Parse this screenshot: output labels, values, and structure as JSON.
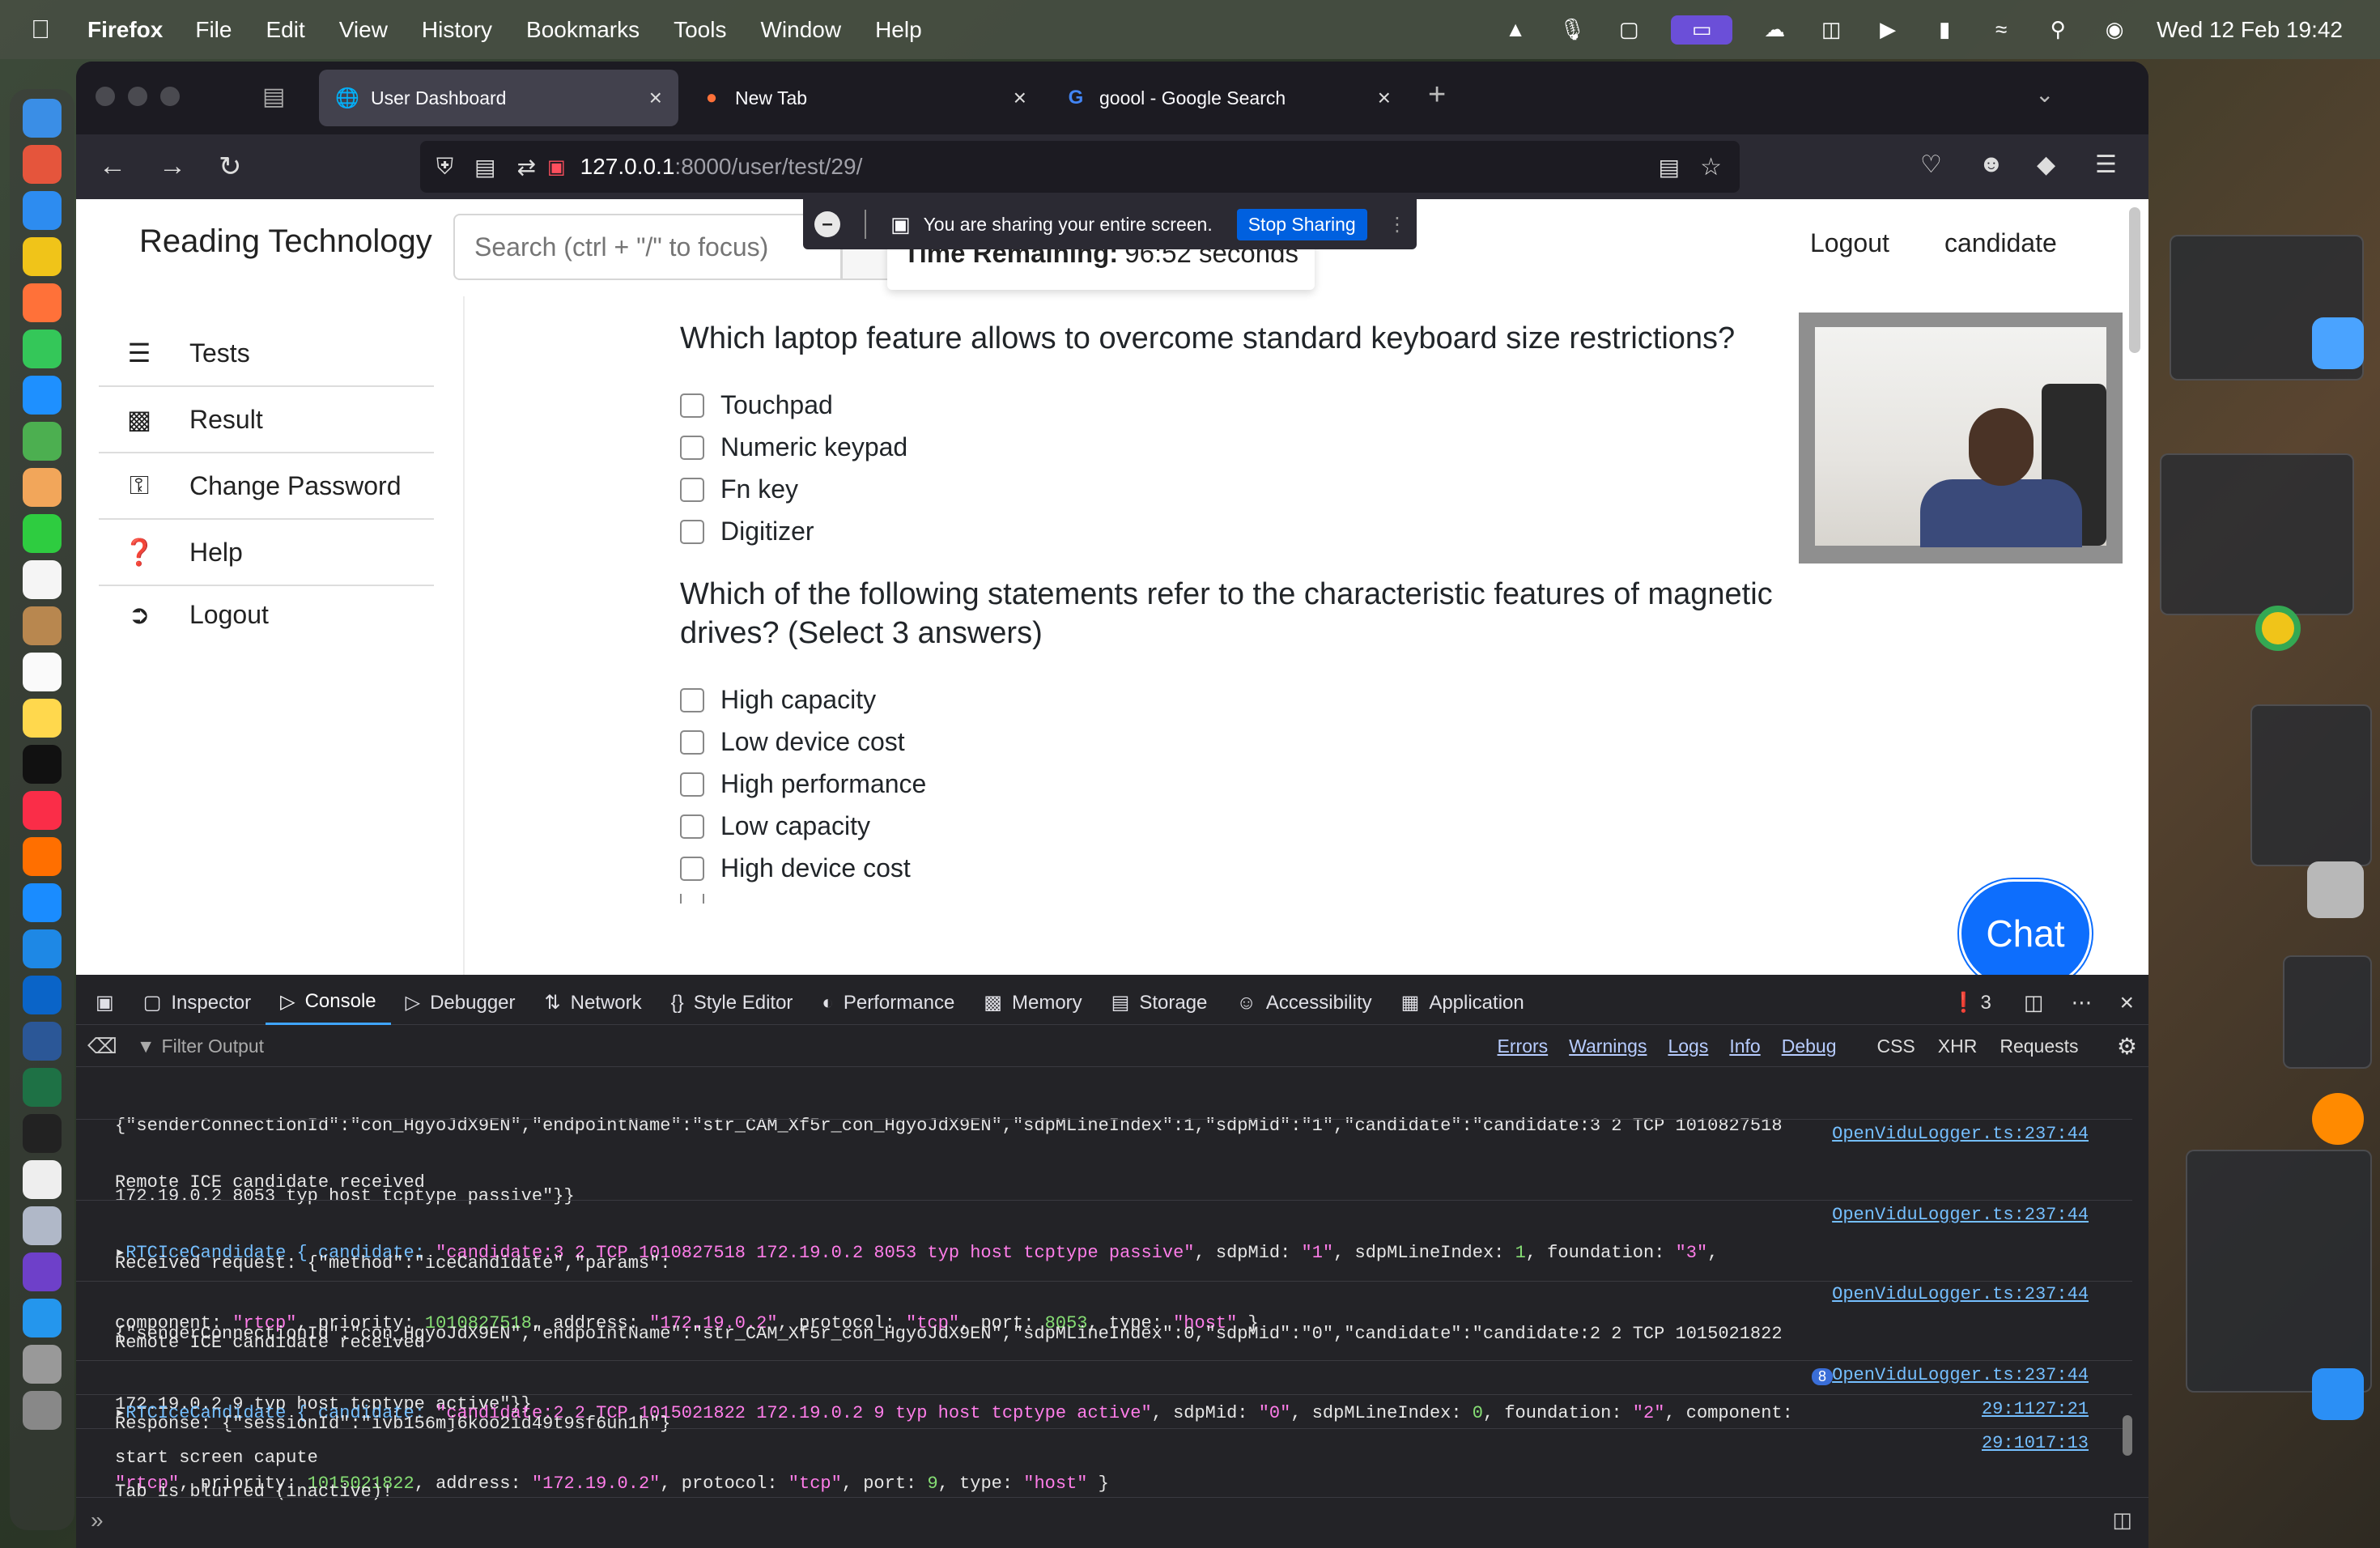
{
  "menubar": {
    "app_name": "Firefox",
    "menus": [
      "File",
      "Edit",
      "View",
      "History",
      "Bookmarks",
      "Tools",
      "Window",
      "Help"
    ],
    "clock": "Wed 12 Feb  19:42"
  },
  "browser": {
    "tabs": [
      {
        "label": "User Dashboard",
        "icon": "globe-icon"
      },
      {
        "label": "New Tab",
        "icon": "firefox-icon"
      },
      {
        "label": "goool - Google Search",
        "icon": "google-icon"
      }
    ],
    "url_host": "127.0.0.1",
    "url_rest": ":8000/user/test/29/"
  },
  "share_bar": {
    "message": "You are sharing your entire screen.",
    "stop_label": "Stop Sharing"
  },
  "site": {
    "brand": "Reading Technology",
    "search_placeholder": "Search (ctrl + \"/\" to focus)",
    "top_links": [
      "Logout",
      "candidate"
    ],
    "sidebar": [
      {
        "label": "Tests",
        "icon": "list-icon"
      },
      {
        "label": "Result",
        "icon": "clipboard-icon"
      },
      {
        "label": "Change Password",
        "icon": "key-icon"
      },
      {
        "label": "Help",
        "icon": "question-circle-icon"
      },
      {
        "label": "Logout",
        "icon": "sign-out-icon"
      }
    ],
    "timer_label": "Time Remaining:",
    "timer_value": "96:52 seconds",
    "chat_label": "Chat"
  },
  "questions": [
    {
      "text": "Which laptop feature allows to overcome standard keyboard size restrictions?",
      "options": [
        "Touchpad",
        "Numeric keypad",
        "Fn key",
        "Digitizer"
      ]
    },
    {
      "text_line1": "Which of the following statements refer to the characteristic features of magnetic",
      "text_line2": "drives? (Select 3 answers)",
      "options": [
        "High capacity",
        "Low device cost",
        "High performance",
        "Low capacity",
        "High device cost"
      ]
    }
  ],
  "devtools": {
    "tabs": [
      "Inspector",
      "Console",
      "Debugger",
      "Network",
      "Style Editor",
      "Performance",
      "Memory",
      "Storage",
      "Accessibility",
      "Application"
    ],
    "active_tab": "Console",
    "error_count": "3",
    "filter_placeholder": "Filter Output",
    "filter_levels": [
      "Errors",
      "Warnings",
      "Logs",
      "Info",
      "Debug"
    ],
    "filter_extra": [
      "CSS",
      "XHR",
      "Requests"
    ],
    "logs": [
      {
        "lines": [
          "{\"senderConnectionId\":\"con_HgyoJdX9EN\",\"endpointName\":\"str_CAM_Xf5r_con_HgyoJdX9EN\",\"sdpMLineIndex\":1,\"sdpMid\":\"1\",\"candidate\":\"candidate:3 2 TCP 1010827518",
          "172.19.0.2 8053 typ host tcptype passive\"}}"
        ],
        "source": ""
      },
      {
        "lines": [
          "Remote ICE candidate received"
        ],
        "source": "OpenViduLogger.ts:237:44"
      },
      {
        "lines": [
          "Received request: {\"method\":\"iceCandidate\",\"params\":",
          "{\"senderConnectionId\":\"con_HgyoJdX9EN\",\"endpointName\":\"str_CAM_Xf5r_con_HgyoJdX9EN\",\"sdpMLineIndex\":0,\"sdpMid\":\"0\",\"candidate\":\"candidate:2 2 TCP 1015021822",
          "172.19.0.2 9 typ host tcptype active\"}}"
        ],
        "source": "OpenViduLogger.ts:237:44"
      },
      {
        "lines": [
          "Remote ICE candidate received"
        ],
        "source": "OpenViduLogger.ts:237:44"
      },
      {
        "lines": [
          "Response: {\"sessionId\":\"ivb156mj6koo2id49t9sf6un1h\"}"
        ],
        "source": "OpenViduLogger.ts:237:44",
        "badge": "8"
      },
      {
        "lines": [
          "start screen capute"
        ],
        "source": "29:1127:21"
      },
      {
        "lines": [
          "Tab is blurred (inactive)!"
        ],
        "source": "29:1017:13"
      }
    ],
    "rtc1": {
      "prefix": "RTCIceCandidate { candidate: ",
      "candidate": "\"candidate:3 2 TCP 1010827518 172.19.0.2 8053 typ host tcptype passive\"",
      "sdpMid": "\"1\"",
      "sdpMLineIndex": "1",
      "foundation": "\"3\"",
      "component": "\"rtcp\"",
      "priority": "1010827518",
      "address": "\"172.19.0.2\"",
      "protocol": "\"tcp\"",
      "port": "8053",
      "type": "\"host\""
    },
    "rtc2": {
      "prefix": "RTCIceCandidate { candidate: ",
      "candidate": "\"candidate:2 2 TCP 1015021822 172.19.0.2 9 typ host tcptype active\"",
      "sdpMid": "\"0\"",
      "sdpMLineIndex": "0",
      "foundation": "\"2\"",
      "component": "\"rtcp\"",
      "priority": "1015021822",
      "address": "\"172.19.0.2\"",
      "protocol": "\"tcp\"",
      "port": "9",
      "type": "\"host\""
    }
  }
}
